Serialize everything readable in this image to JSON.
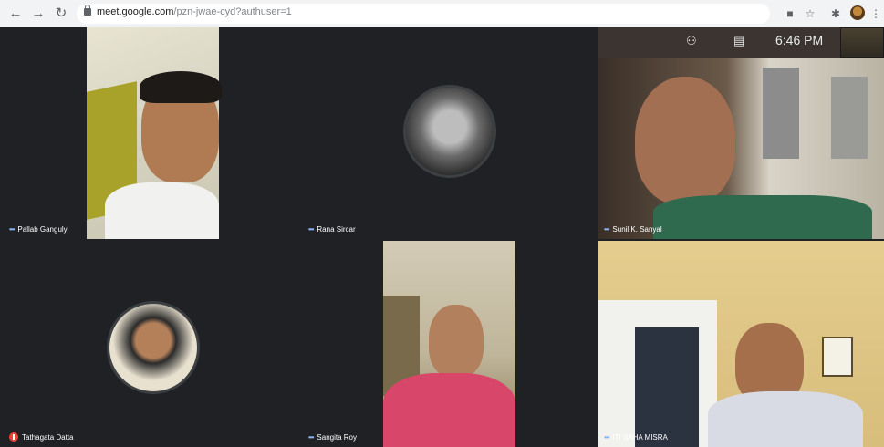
{
  "browser": {
    "url_host": "meet.google.com",
    "url_rest": "/pzn-jwae-cyd?authuser=1",
    "icons": [
      "back-icon",
      "forward-icon",
      "reload-icon",
      "lock-icon",
      "cast-icon",
      "star-icon",
      "extensions-icon",
      "profile-avatar",
      "more-icon"
    ]
  },
  "meet": {
    "time": "6:46 PM",
    "toolbar_icons": [
      "people-icon",
      "chat-icon"
    ],
    "participants": [
      {
        "name": "Pallab Ganguly",
        "muted": false
      },
      {
        "name": "Rana Sircar",
        "muted": false
      },
      {
        "name": "Sunil K. Sanyal",
        "muted": false
      },
      {
        "name": "Tathagata Datta",
        "muted": true
      },
      {
        "name": "Sangita Roy",
        "muted": false
      },
      {
        "name": "ITI SAHA MISRA",
        "muted": false
      }
    ]
  }
}
